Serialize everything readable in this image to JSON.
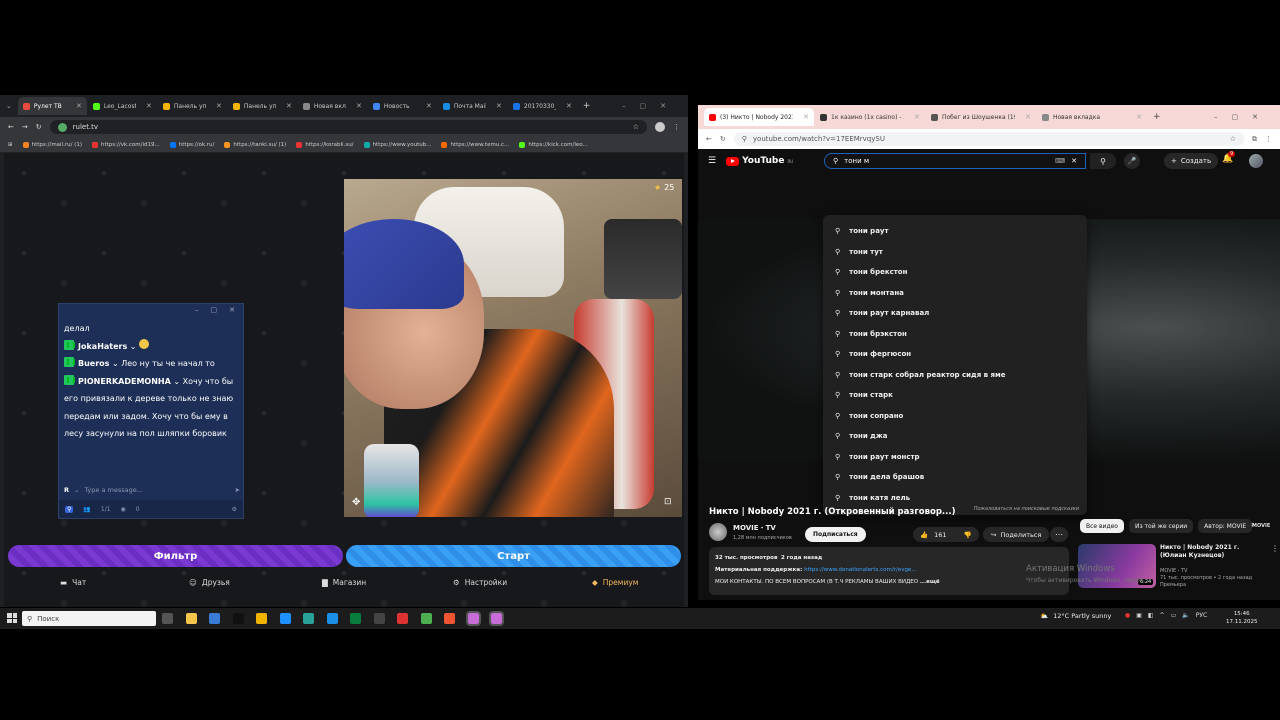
{
  "left_browser": {
    "tabs": [
      {
        "label": "Рулет ТВ",
        "color": "#e84b3c",
        "active": true
      },
      {
        "label": "Leo_Lacoste St",
        "color": "#53fc18"
      },
      {
        "label": "Панель управ",
        "color": "#f4b400"
      },
      {
        "label": "Панель управ",
        "color": "#f4b400"
      },
      {
        "label": "Новая вкладк",
        "color": "#888888"
      },
      {
        "label": "Новость",
        "color": "#4285f4"
      },
      {
        "label": "Почта Mail",
        "color": "#168de2"
      },
      {
        "label": "20170330_174",
        "color": "#1a73e8"
      }
    ],
    "url": "rulet.tv",
    "bookmarks": [
      "https://mail.ru/ (1)",
      "https://vk.com/id19...",
      "https://ok.ru/",
      "https://tanki.su/ (1)",
      "https://korabli.su/",
      "https://www.youtub...",
      "https://www.temu.c...",
      "https://kick.com/leo..."
    ]
  },
  "stream": {
    "star_count": "25",
    "chat": {
      "first_line": "делал",
      "messages": [
        {
          "nick": "JokaHaters",
          "text": ""
        },
        {
          "nick": "Bueros",
          "text": "Лео ну ты че начал то"
        },
        {
          "nick": "PIONERKADEMONHA",
          "text": "Хочу что бы его привязали к дереве только не знаю передам или задом. Хочу что бы ему в лесу засунули на пол шляпки боровик"
        }
      ],
      "input_placeholder": "Type a message...",
      "input_prefix": "R",
      "footer_count1": "1/1",
      "footer_count2": "0"
    },
    "btn_filter": "Фильтр",
    "btn_start": "Старт",
    "nav": {
      "chat": "Чат",
      "friends": "Друзья",
      "shop": "Магазин",
      "settings": "Настройки",
      "premium": "Премиум"
    }
  },
  "right_browser": {
    "tabs": [
      {
        "label": "(3) Никто | Nobody 2021 г. (О",
        "color": "#ff0000",
        "active": true
      },
      {
        "label": "1к казино (1x casino) - Зеркал",
        "color": "#333333"
      },
      {
        "label": "Побег из Шоушенка (1994) сл",
        "color": "#555555"
      },
      {
        "label": "Новая вкладка",
        "color": "#888888"
      }
    ],
    "url": "youtube.com/watch?v=17EEMrvqySU"
  },
  "youtube": {
    "logo": "YouTube",
    "logo_suffix": "RU",
    "search_value": "тони м",
    "create_label": "Создать",
    "notif_count": "9",
    "suggestions": [
      "тони раут",
      "тони тут",
      "тони брекстон",
      "тони монтана",
      "тони раут карнавал",
      "тони брэкстон",
      "тони фергюсон",
      "тони старк собрал реактор сидя в яме",
      "тони старк",
      "тони сопрано",
      "тони джа",
      "тони раут монстр",
      "тони дела брашов",
      "тони катя лель"
    ],
    "suggest_footer": "Пожаловаться на поисковые подсказки",
    "movie_tag": "MOVIE",
    "title": "Никто | Nobody 2021 г. (Откровенный разговор...)",
    "channel": "MOVIE ꞏ TV",
    "subs": "1,28 млн подписчиков",
    "subscribe": "Подписаться",
    "likes": "161",
    "share": "Поделиться",
    "views": "32 тыс. просмотров",
    "ago": "2 года назад",
    "support_label": "Материальная поддержка:",
    "support_link": "https://www.donationalerts.com/r/evge...",
    "contacts": "МОИ КОНТАКТЫ. ПО ВСЕМ ВОПРОСАМ (В Т.Ч РЕКЛАМЫ ВАШИХ ВИДЕО",
    "more": "...ещё",
    "chips": [
      "Все видео",
      "Из той же серии",
      "Автор: MOVIE"
    ],
    "rec": {
      "title": "Никто | Nobody 2021 г. (Юлиан Кузнецов)",
      "channel": "MOVIE ꞏ TV",
      "meta": "71 тыс. просмотров • 2 года назад",
      "new": "Премьера",
      "duration": "6:24"
    },
    "win_activation": "Активация Windows",
    "win_activation_sub": "Чтобы активировать Windows, перей..."
  },
  "taskbar": {
    "search": "Поиск",
    "weather": "12°C  Partly sunny",
    "lang": "РУС",
    "time": "15:46",
    "date": "17.11.2025"
  }
}
